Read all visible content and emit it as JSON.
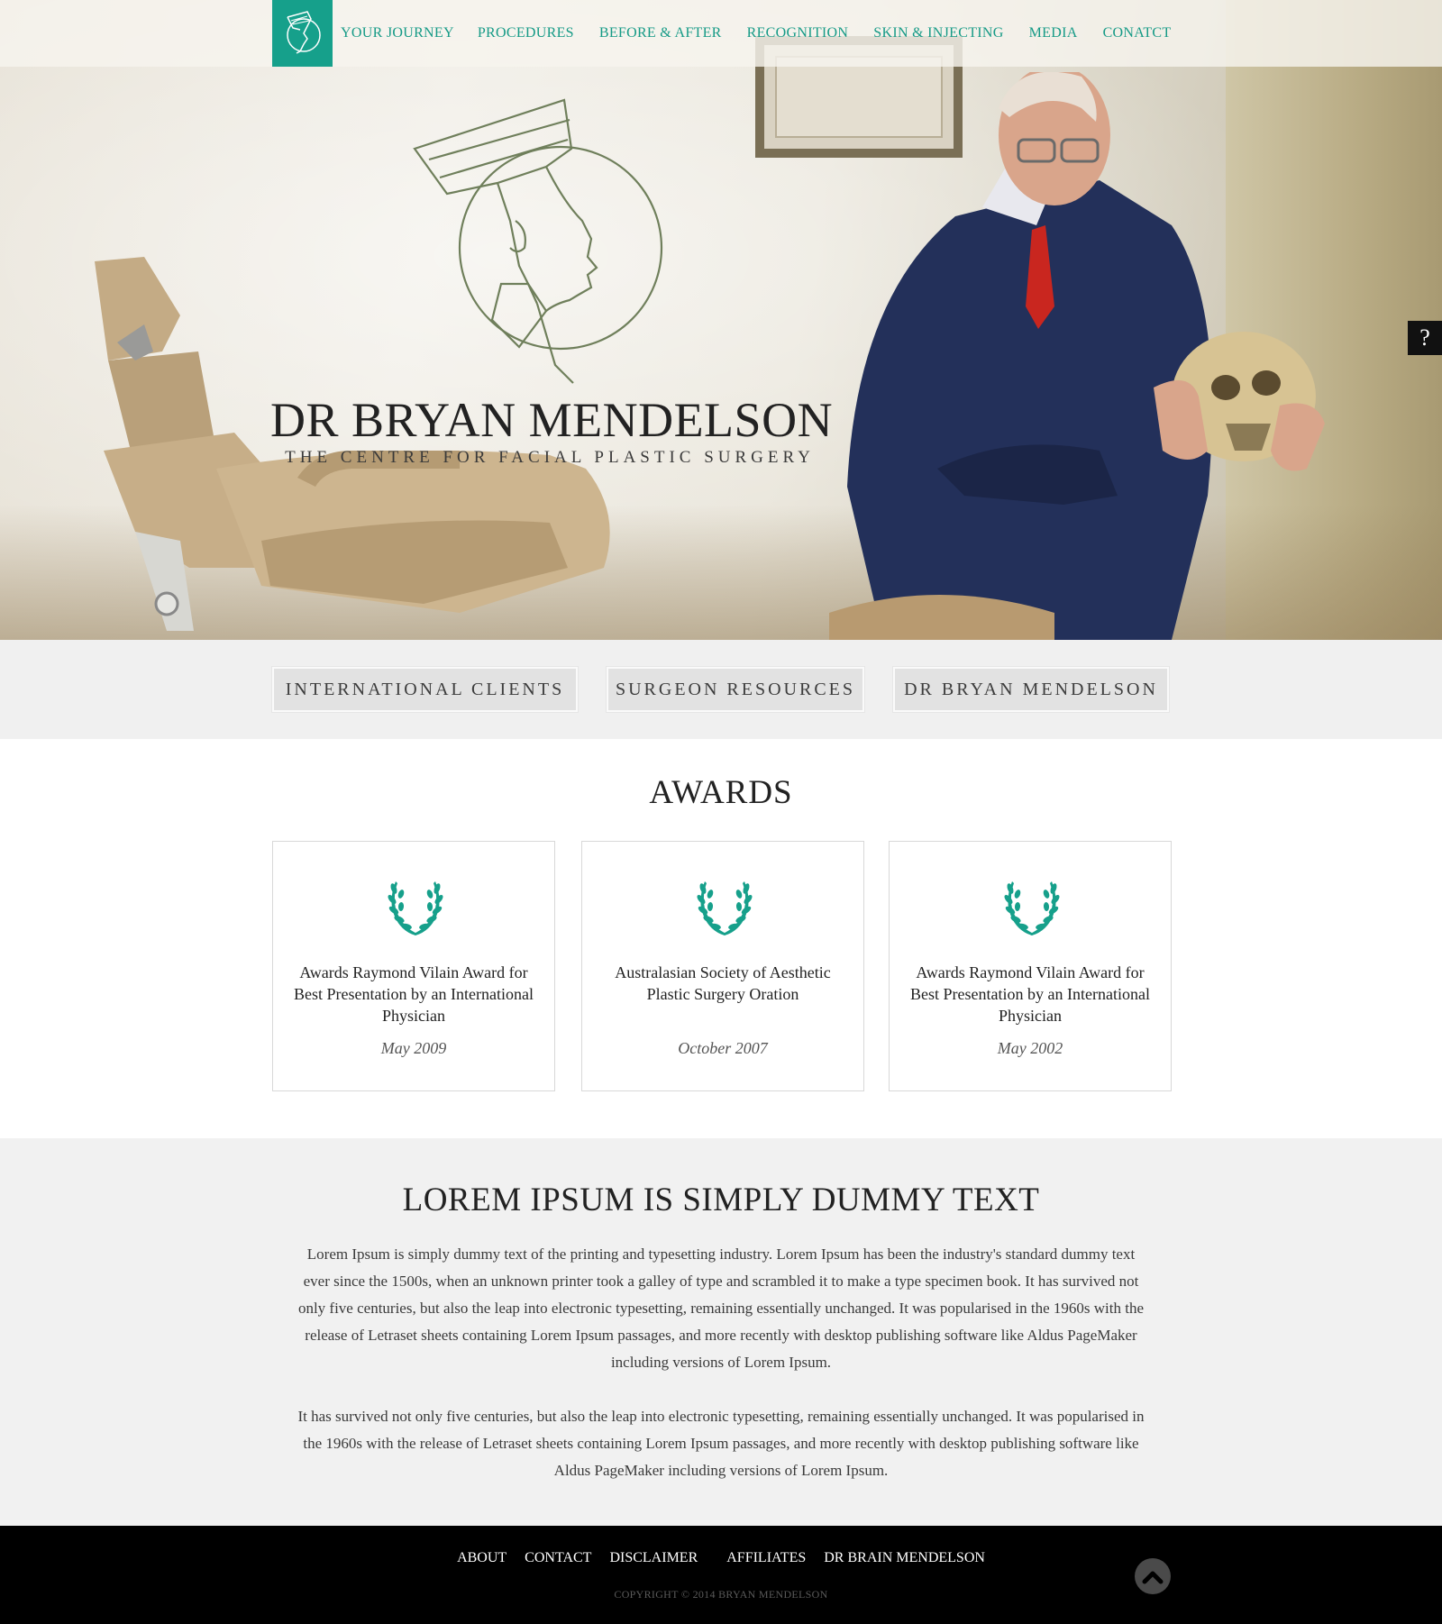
{
  "nav": {
    "items": [
      "Your Journey",
      "Procedures",
      "Before & After",
      "Recognition",
      "Skin & Injecting",
      "Media",
      "Conatct"
    ]
  },
  "hero": {
    "title": "DR BRYAN MENDELSON",
    "subtitle": "THE CENTRE FOR FACIAL PLASTIC SURGERY"
  },
  "help": {
    "label": "?"
  },
  "quick_links": [
    {
      "label": "International Clients"
    },
    {
      "label": "Surgeon Resources"
    },
    {
      "label": "Dr Bryan Mendelson"
    }
  ],
  "awards": {
    "title": "AWARDS",
    "items": [
      {
        "name": "Awards Raymond Vilain Award for Best Presentation by an International Physician",
        "date": "May 2009"
      },
      {
        "name": "Australasian Society of Aesthetic Plastic Surgery Oration",
        "date": "October 2007"
      },
      {
        "name": "Awards Raymond Vilain Award for Best Presentation by an International Physician",
        "date": "May 2002"
      }
    ]
  },
  "lorem": {
    "title": "LOREM IPSUM IS SIMPLY DUMMY TEXT",
    "paragraphs": [
      "Lorem Ipsum is simply dummy text of the printing and typesetting industry. Lorem Ipsum has been the industry's standard dummy text ever since the 1500s, when an unknown printer took a galley of type and scrambled it to make a type specimen book. It has survived not only five centuries, but also the leap into electronic typesetting, remaining essentially unchanged. It was popularised in the 1960s with the release of Letraset sheets containing Lorem Ipsum passages, and more recently with desktop publishing software like Aldus PageMaker including versions of Lorem Ipsum.",
      "It has survived not only five centuries, but also the leap into electronic typesetting, remaining essentially unchanged. It was popularised in the 1960s with the release of Letraset sheets containing Lorem Ipsum passages, and more recently with desktop publishing software like Aldus PageMaker including versions of Lorem Ipsum."
    ]
  },
  "footer": {
    "links": [
      "About",
      "Contact",
      "Disclaimer",
      "Affiliates",
      "Dr Brain Mendelson"
    ],
    "copyright": "COPYRIGHT © 2014 BRYAN MENDELSON"
  },
  "colors": {
    "accent": "#16a08b",
    "footer_bg": "#000000",
    "band_bg": "#f0f0f0"
  },
  "icons": {
    "logo": "nefertiti-icon",
    "award": "laurel-icon",
    "back_to_top": "chevron-up-icon"
  }
}
